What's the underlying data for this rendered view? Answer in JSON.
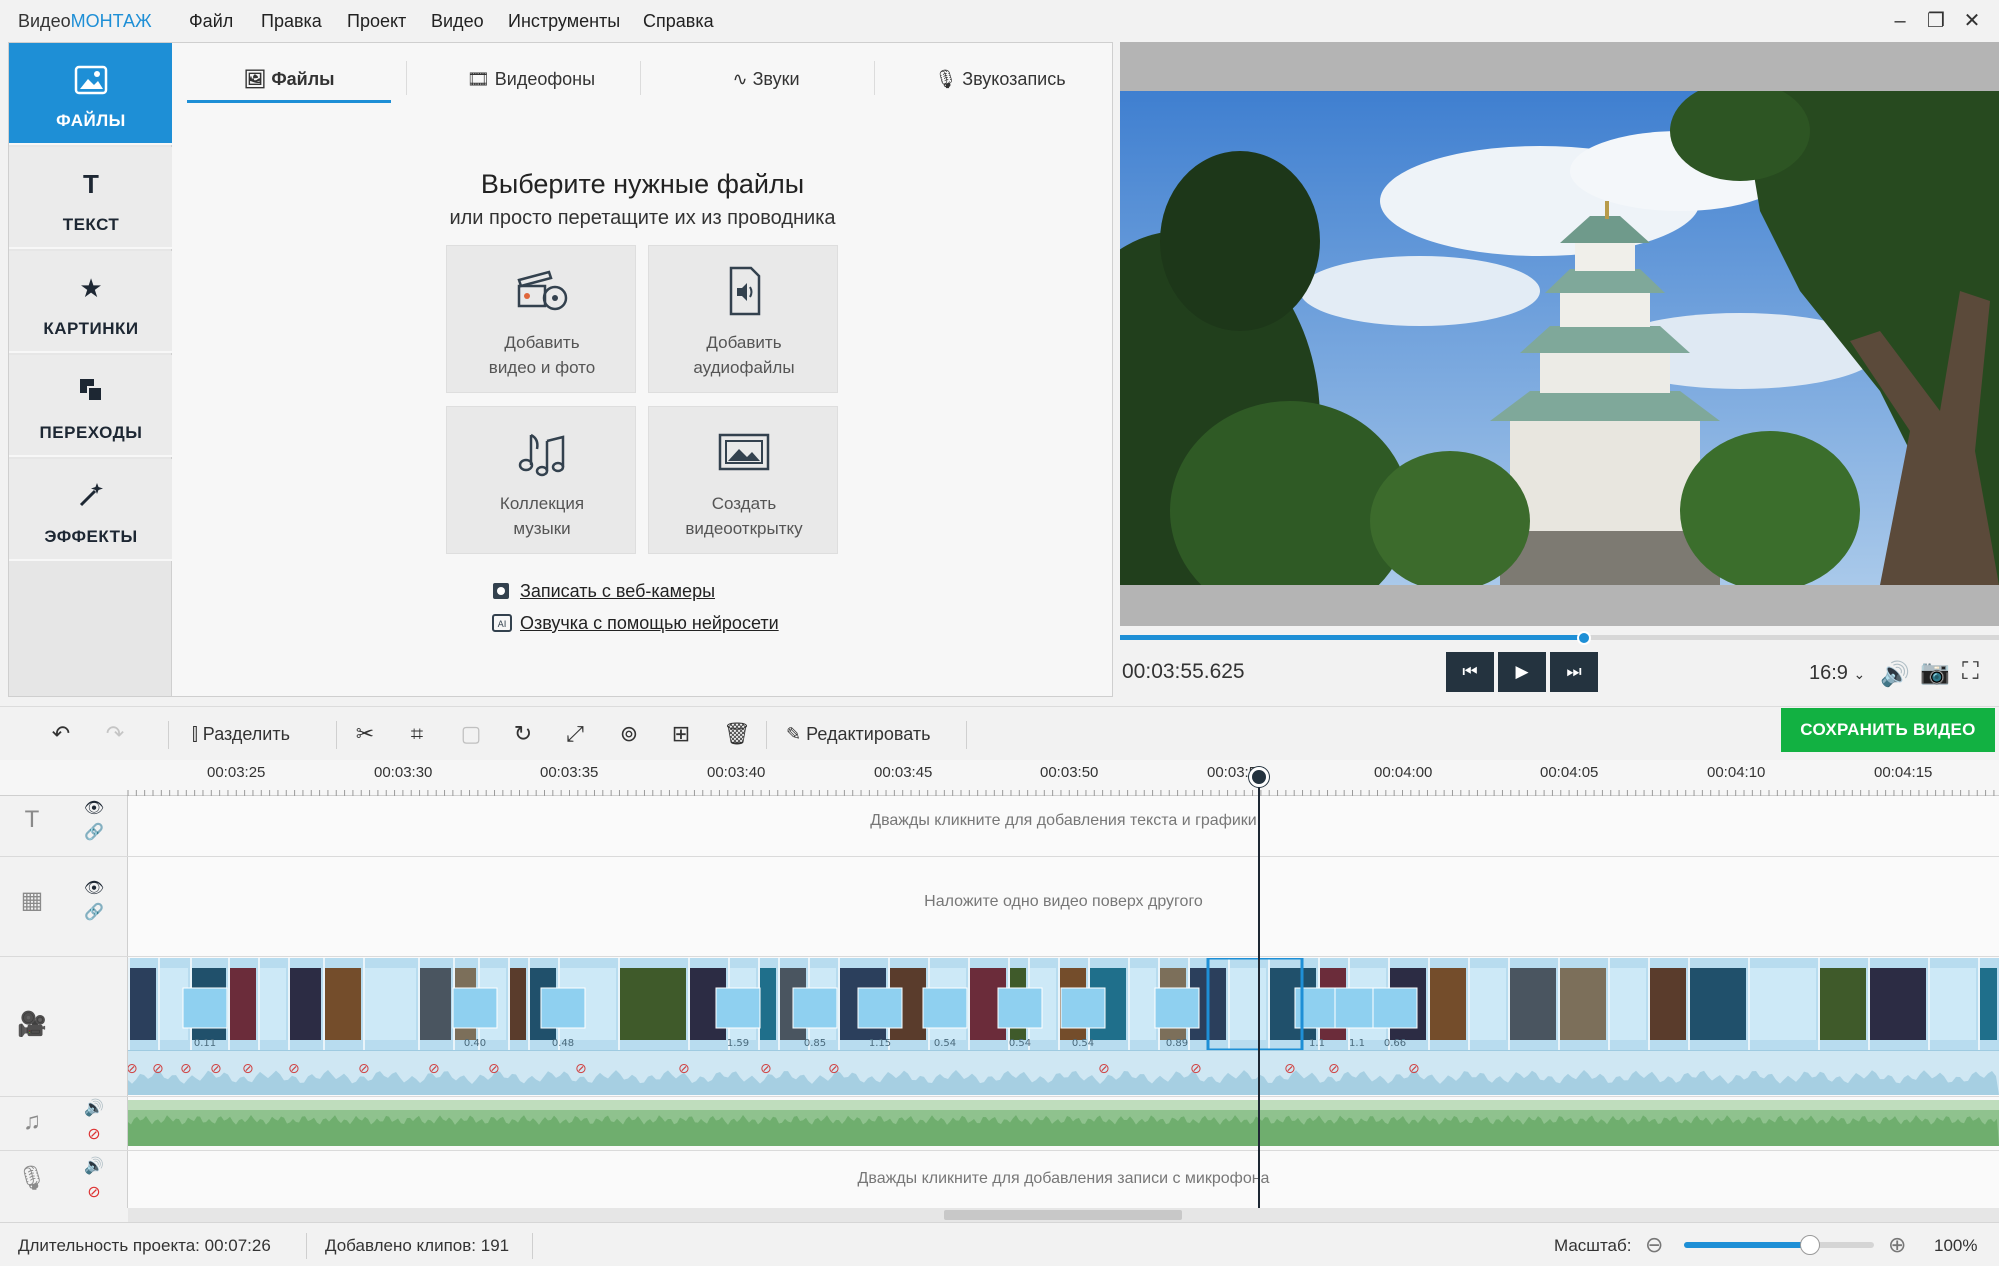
{
  "app": {
    "logo_prefix": "Видео",
    "logo_accent": "МОНТАЖ",
    "menu": [
      "Файл",
      "Правка",
      "Проект",
      "Видео",
      "Инструменты",
      "Справка"
    ],
    "window_controls": [
      "minimize-icon",
      "restore-icon",
      "close-icon"
    ]
  },
  "sidebar": {
    "items": [
      {
        "label": "ФАЙЛЫ",
        "icon": "image-icon",
        "active": true
      },
      {
        "label": "ТЕКСТ",
        "icon": "text-icon",
        "active": false
      },
      {
        "label": "КАРТИНКИ",
        "icon": "star-icon",
        "active": false
      },
      {
        "label": "ПЕРЕХОДЫ",
        "icon": "transitions-icon",
        "active": false
      },
      {
        "label": "ЭФФЕКТЫ",
        "icon": "magic-wand-icon",
        "active": false
      }
    ]
  },
  "files_panel": {
    "tabs": [
      {
        "label": "Файлы",
        "active": true
      },
      {
        "label": "Видеофоны",
        "active": false
      },
      {
        "label": "Звуки",
        "active": false
      },
      {
        "label": "Звукозапись",
        "active": false
      }
    ],
    "title": "Выберите нужные файлы",
    "subtitle": "или просто перетащите их из проводника",
    "tiles": [
      {
        "line1": "Добавить",
        "line2": "видео и фото",
        "icon": "film-camera-icon"
      },
      {
        "line1": "Добавить",
        "line2": "аудиофайлы",
        "icon": "audio-file-icon"
      },
      {
        "line1": "Коллекция",
        "line2": "музыки",
        "icon": "music-notes-icon"
      },
      {
        "line1": "Создать",
        "line2": "видеооткрытку",
        "icon": "postcard-icon"
      }
    ],
    "links": [
      {
        "label": "Записать с веб-камеры",
        "icon": "webcam-icon"
      },
      {
        "label": "Озвучка с помощью нейросети",
        "icon": "ai-icon"
      }
    ]
  },
  "preview": {
    "time": "00:03:55.625",
    "progress": 0.528,
    "aspect_ratio": "16:9",
    "controls": [
      "skip-back-icon",
      "play-icon",
      "skip-forward-icon"
    ]
  },
  "toolbar": {
    "split_label": "Разделить",
    "edit_label": "Редактировать",
    "save_label": "СОХРАНИТЬ ВИДЕО"
  },
  "timeline": {
    "ruler": [
      "00:03:25",
      "00:03:30",
      "00:03:35",
      "00:03:40",
      "00:03:45",
      "00:03:50",
      "00:03:55",
      "00:04:00",
      "00:04:05",
      "00:04:10",
      "00:04:15"
    ],
    "text_track_hint": "Дважды кликните для добавления текста и графики",
    "overlay_track_hint": "Наложите одно видео поверх другого",
    "mic_track_hint": "Дважды кликните для добавления записи с микрофона",
    "transition_values": [
      "0.11",
      "0.40",
      "0.48",
      "1.59",
      "0.85",
      "1.15",
      "0.54",
      "0.54",
      "0.54",
      "0.89",
      "1.1",
      "1.1",
      "0.66"
    ]
  },
  "status": {
    "duration_label": "Длительность проекта:",
    "duration_value": "00:07:26",
    "clips_label": "Добавлено клипов:",
    "clips_value": "191",
    "zoom_label": "Масштаб:",
    "zoom_value": "100%",
    "zoom_level": 0.66
  },
  "colors": {
    "accent": "#1e8fd6",
    "save_green": "#12b142",
    "video_track": "#b8dcef",
    "music_track": "#8fc28e"
  }
}
